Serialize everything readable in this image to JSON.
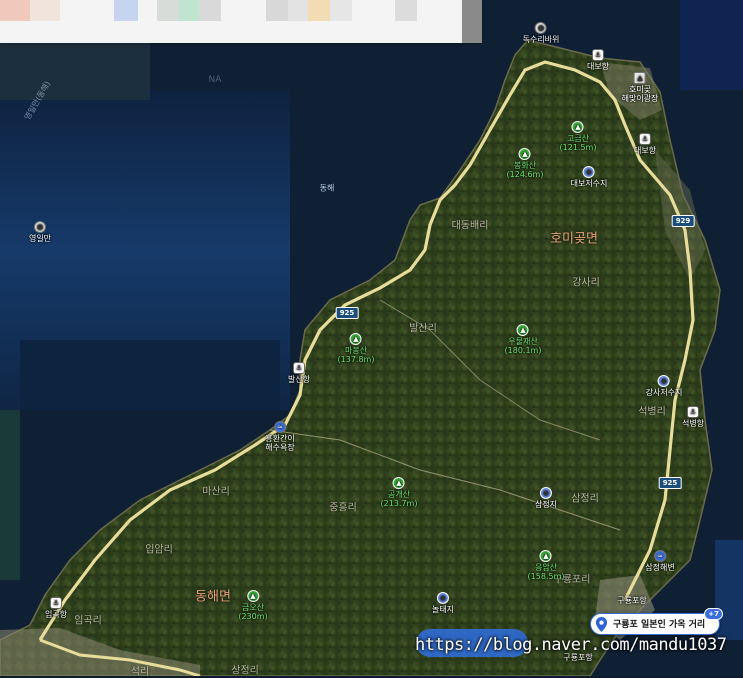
{
  "map": {
    "sea_label": "동해",
    "districts": [
      "호미곶면",
      "동해면"
    ],
    "route_numbers": [
      "925",
      "929",
      "925"
    ],
    "villages": [
      "대동배리",
      "강사리",
      "발산리",
      "마산리",
      "중흥리",
      "입암리",
      "임곡리",
      "삼정리",
      "석병리",
      "구룡포리",
      "상정리",
      "석리"
    ],
    "pois": {
      "dugsuri": "독수리바위",
      "daebohang": "대보항",
      "homigot_plaza": "호미곶\n해맞이광장",
      "daebo_port2": "대보항",
      "gogeumsan": "고금산\n(121.5m)",
      "bonghwasan": "봉화산\n(124.6m)",
      "daebo_reservoir": "대보저수지",
      "yeongilman": "영일만",
      "mabongsan": "마봉산\n(137.8m)",
      "uraejaesan": "우물재산\n(180.1m)",
      "balsanhang": "발산항",
      "heunghwan": "흥환간이\n해수욕장",
      "gangsa_reservoir": "강사저수지",
      "seokbyeonghang": "석병항",
      "gonggaesan": "공개산\n(213.7m)",
      "samjeongji": "삼정지",
      "samjeong_beach": "삼정해변",
      "eungamsan": "응암산\n(158.5m)",
      "noltaeji": "놀태지",
      "gumunsan": "금오산\n(230m)",
      "imgokhang": "임곡항",
      "guryongpohang": "구룡포항",
      "guryongpo_port": "구룡포항"
    },
    "faint_labels": {
      "left_coast": "영일만(동해)",
      "road_top_left": "NA"
    }
  },
  "search_pin": {
    "label": "구룡포 일본인 가옥 거리",
    "badge": "+7"
  },
  "watermark": {
    "text": "https://blog.naver.com/mandu1037"
  },
  "colors": {
    "sea_deep": "#0f2a4e",
    "sea_light": "#1d4a80",
    "land": "#34441f",
    "road": "#e7dc9a",
    "pin_blue": "#3b6edc"
  }
}
